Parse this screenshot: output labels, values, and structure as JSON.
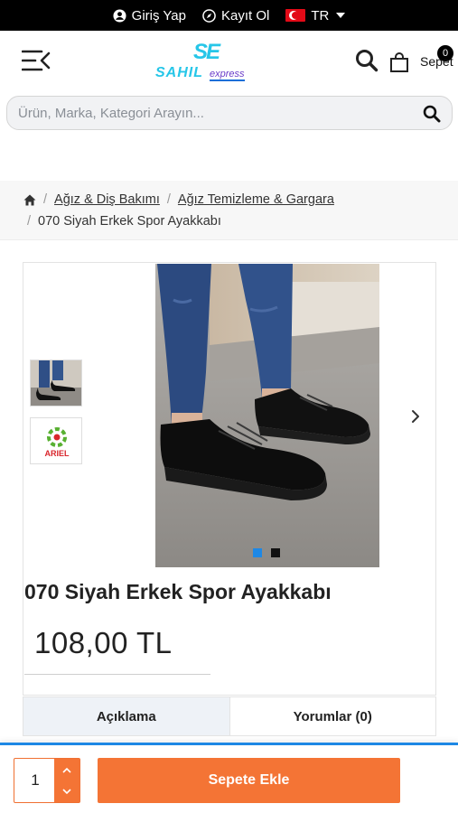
{
  "topbar": {
    "login_label": "Giriş Yap",
    "login_icon": "user-circle-icon",
    "register_label": "Kayıt Ol",
    "register_icon": "compass-icon",
    "language_label": "TR",
    "language_flag": "turkey-flag-icon"
  },
  "header": {
    "menu_icon": "menu-collapse-icon",
    "logo_se": "SE",
    "logo_sahil": "SAHIL",
    "logo_express": "express",
    "search_icon": "search-icon",
    "cart_icon": "shopping-bag-icon",
    "cart_count": "0",
    "cart_label": "Sepet"
  },
  "search": {
    "placeholder": "Ürün, Marka, Kategori Arayın..."
  },
  "breadcrumb": {
    "home_icon": "home-icon",
    "separator": "/",
    "items": [
      "Ağız & Diş Bakımı",
      "Ağız Temizleme & Gargara"
    ],
    "current": "070 Siyah Erkek Spor Ayakkabı"
  },
  "product": {
    "title": "070 Siyah Erkek Spor Ayakkabı",
    "price": "108,00 TL",
    "thumbnails": [
      "shoe-photo-thumbnail",
      "ariel-logo-thumbnail"
    ],
    "thumb2_text": "ARIEL",
    "slider_dots": 2,
    "active_dot": 0,
    "colors": {
      "active_dot": "#1e88e5",
      "inactive_dot": "#111111"
    }
  },
  "tabs": [
    {
      "label": "Açıklama",
      "active": true
    },
    {
      "label": "Yorumlar (0)",
      "active": false
    }
  ],
  "purchase": {
    "quantity": "1",
    "add_to_cart_label": "Sepete Ekle",
    "colors": {
      "accent": "#f47435",
      "border": "#1e88e5"
    }
  }
}
